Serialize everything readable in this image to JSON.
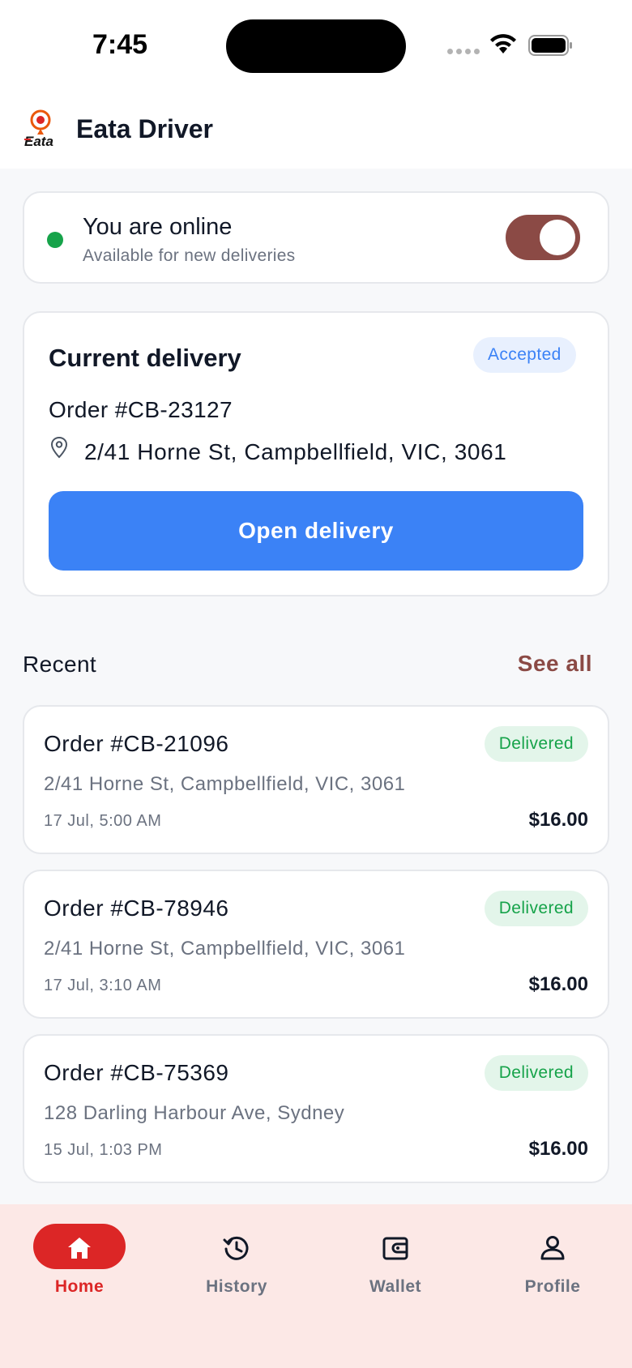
{
  "status_bar": {
    "time": "7:45"
  },
  "app": {
    "title": "Eata Driver",
    "logo_text": "Eata"
  },
  "online": {
    "title": "You are online",
    "subtitle": "Available for new deliveries",
    "toggle_on": true
  },
  "current_delivery": {
    "heading": "Current delivery",
    "status": "Accepted",
    "order": "Order #CB-23127",
    "address": "2/41 Horne St, Campbellfield, VIC, 3061",
    "button_label": "Open delivery"
  },
  "recent": {
    "title": "Recent",
    "see_all": "See all",
    "orders": [
      {
        "order": "Order #CB-21096",
        "status": "Delivered",
        "address": "2/41 Horne St, Campbellfield, VIC, 3061",
        "time": "17 Jul, 5:00 AM",
        "price": "$16.00"
      },
      {
        "order": "Order #CB-78946",
        "status": "Delivered",
        "address": "2/41 Horne St, Campbellfield, VIC, 3061",
        "time": "17 Jul, 3:10 AM",
        "price": "$16.00"
      },
      {
        "order": "Order #CB-75369",
        "status": "Delivered",
        "address": "128 Darling Harbour Ave, Sydney",
        "time": "15 Jul, 1:03 PM",
        "price": "$16.00"
      }
    ]
  },
  "nav": {
    "items": [
      {
        "label": "Home",
        "icon": "home-icon",
        "active": true
      },
      {
        "label": "History",
        "icon": "history-icon",
        "active": false
      },
      {
        "label": "Wallet",
        "icon": "wallet-icon",
        "active": false
      },
      {
        "label": "Profile",
        "icon": "profile-icon",
        "active": false
      }
    ]
  },
  "colors": {
    "accent_blue": "#3b82f6",
    "brand_maroon": "#8b4a45",
    "nav_active": "#dc2626",
    "online_green": "#16a34a"
  }
}
